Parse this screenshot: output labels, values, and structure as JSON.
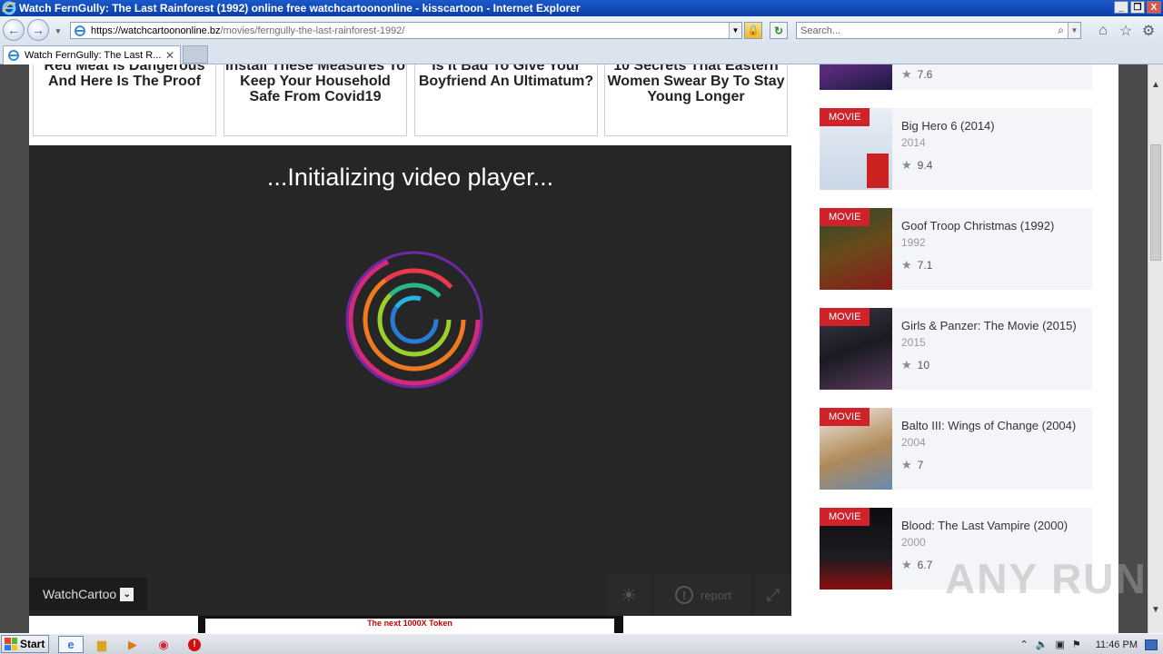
{
  "window": {
    "title": "Watch FernGully: The Last Rainforest (1992) online free watchcartoononline - kisscartoon - Internet Explorer",
    "min": "_",
    "restore": "❐",
    "close": "X"
  },
  "address": {
    "host": "https://watchcartoononline.bz",
    "path": "/movies/ferngully-the-last-rainforest-1992/"
  },
  "search": {
    "placeholder": "Search..."
  },
  "tab": {
    "label": "Watch FernGully: The Last R...",
    "close": "✕"
  },
  "ads": [
    "Red Meat Is Dangerous And Here Is The Proof",
    "Install These Measures To Keep Your Household Safe From Covid19",
    "Is It Bad To Give Your Boyfriend An Ultimatum?",
    "10 Secrets That Eastern Women Swear By To Stay Young Longer"
  ],
  "player": {
    "status": "...Initializing video player...",
    "server_label": "WatchCartoo",
    "report_label": "report"
  },
  "banner": {
    "text": "The next 1000X Token"
  },
  "sidebar": {
    "top_rating": "7.6",
    "movies": [
      {
        "badge": "MOVIE",
        "title": "Big Hero 6 (2014)",
        "year": "2014",
        "rating": "9.4"
      },
      {
        "badge": "MOVIE",
        "title": "Goof Troop Christmas (1992)",
        "year": "1992",
        "rating": "7.1"
      },
      {
        "badge": "MOVIE",
        "title": "Girls & Panzer: The Movie (2015)",
        "year": "2015",
        "rating": "10"
      },
      {
        "badge": "MOVIE",
        "title": "Balto III: Wings of Change (2004)",
        "year": "2004",
        "rating": "7"
      },
      {
        "badge": "MOVIE",
        "title": "Blood: The Last Vampire (2000)",
        "year": "2000",
        "rating": "6.7"
      }
    ]
  },
  "watermark": "ANY RUN",
  "taskbar": {
    "start": "Start",
    "time": "11:46 PM"
  },
  "colors": {
    "badge": "#d0222b",
    "player_bg": "#262626",
    "titlebar": "#1b58c9"
  }
}
